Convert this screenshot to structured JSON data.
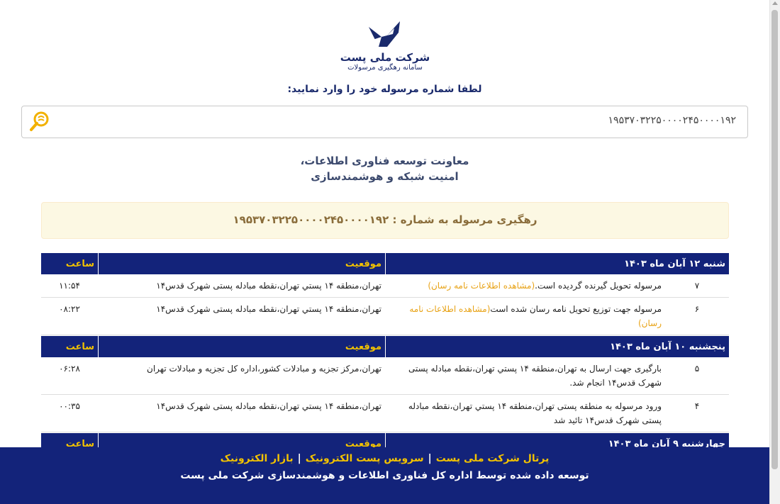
{
  "logo": {
    "name": "شرکت ملی پست",
    "subtitle": "سامانه رهگیری مرسولات"
  },
  "prompt": "لطفا شماره مرسوله خود را وارد نمایید:",
  "search": {
    "value": "۱۹۵۳۷۰۳۲۲۵۰۰۰۰۲۴۵۰۰۰۰۱۹۲"
  },
  "department": {
    "line1": "معاونت توسعه فناوری اطلاعات،",
    "line2": "امنیت شبکه و هوشمندسازی"
  },
  "banner": "رهگیری مرسوله به شماره : ۱۹۵۳۷۰۳۲۲۵۰۰۰۰۲۴۵۰۰۰۰۱۹۲",
  "headers": {
    "location": "موقعیت",
    "time": "ساعت"
  },
  "days": [
    {
      "date": "شنبه ۱۲ آبان ماه ۱۴۰۳",
      "rows": [
        {
          "num": "۷",
          "desc": "مرسوله تحویل گیرنده گردیده است.",
          "link": "(مشاهده اطلاعات نامه رسان)",
          "loc": "تهران،منطقه ۱۴ پستي تهران،نقطه مبادله پستی شهرک قدس۱۴",
          "time": "۱۱:۵۴"
        },
        {
          "num": "۶",
          "desc": "مرسوله جهت توزیع تحویل نامه رسان شده است",
          "link": "(مشاهده اطلاعات نامه رسان)",
          "loc": "تهران،منطقه ۱۴ پستي تهران،نقطه مبادله پستی شهرک قدس۱۴",
          "time": "۰۸:۲۲"
        }
      ]
    },
    {
      "date": "پنجشنبه ۱۰ آبان ماه ۱۴۰۳",
      "rows": [
        {
          "num": "۵",
          "desc": "بارگیری جهت ارسال به تهران،منطقه ۱۴ پستي تهران،نقطه مبادله پستی شهرک قدس۱۴ انجام شد.",
          "link": "",
          "loc": "تهران،مرکز تجزیه و مبادلات کشور،اداره کل تجزیه و مبادلات تهران",
          "time": "۰۶:۲۸"
        },
        {
          "num": "۴",
          "desc": "ورود مرسوله به منطقه پستی تهران،منطقه ۱۴ پستي تهران،نقطه مبادله پستی شهرک قدس۱۴ تائید شد",
          "link": "",
          "loc": "تهران،منطقه ۱۴ پستي تهران،نقطه مبادله پستی شهرک قدس۱۴",
          "time": "۰۰:۳۵"
        }
      ]
    },
    {
      "date": "چهارشنبه ۹ آبان ماه ۱۴۰۳",
      "rows": []
    }
  ],
  "footer": {
    "links": [
      "پرتال شرکت ملی پست",
      "سرویس پست الکترونیک",
      "بازار الکترونیک"
    ],
    "credit": "توسعه داده شده توسط اداره کل فناوری اطلاعات و هوشمندسازی شرکت ملی پست"
  },
  "colors": {
    "navy": "#13237a",
    "gold": "#f2c200",
    "link": "#e8a317",
    "banner_bg": "#fcf8e3",
    "banner_text": "#8a6d3b"
  }
}
